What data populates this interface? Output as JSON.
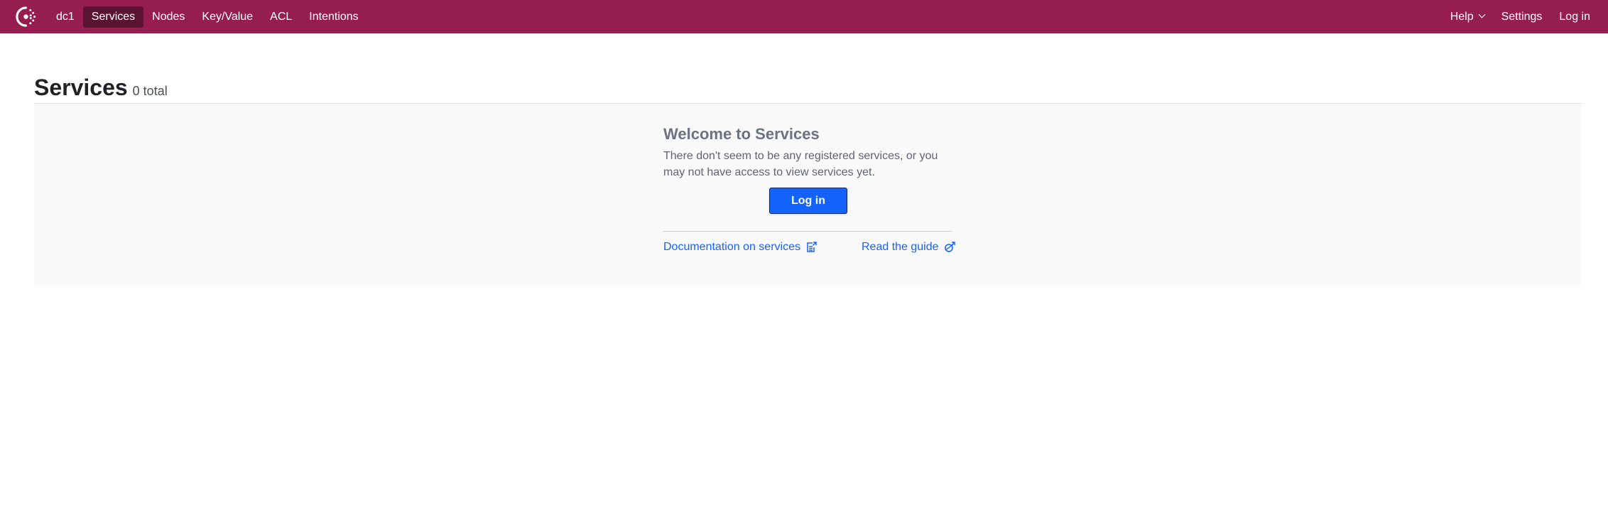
{
  "nav": {
    "logo_icon": "consul-logo-icon",
    "datacenter": "dc1",
    "items": [
      {
        "label": "Services",
        "active": true
      },
      {
        "label": "Nodes",
        "active": false
      },
      {
        "label": "Key/Value",
        "active": false
      },
      {
        "label": "ACL",
        "active": false
      },
      {
        "label": "Intentions",
        "active": false
      }
    ],
    "right": {
      "help_label": "Help",
      "settings_label": "Settings",
      "login_label": "Log in"
    }
  },
  "page": {
    "title": "Services",
    "count": "0 total"
  },
  "empty_state": {
    "title": "Welcome to Services",
    "body": "There don't seem to be any registered services, or you may not have access to view services yet.",
    "login_button": "Log in",
    "links": {
      "docs_label": "Documentation on services",
      "docs_icon": "docs-icon",
      "guide_label": "Read the guide",
      "guide_icon": "guide-icon"
    }
  },
  "colors": {
    "nav_bg": "#961d4f",
    "nav_active": "#5a1432",
    "primary": "#1563ff",
    "panel_bg": "#f9f9fa"
  }
}
